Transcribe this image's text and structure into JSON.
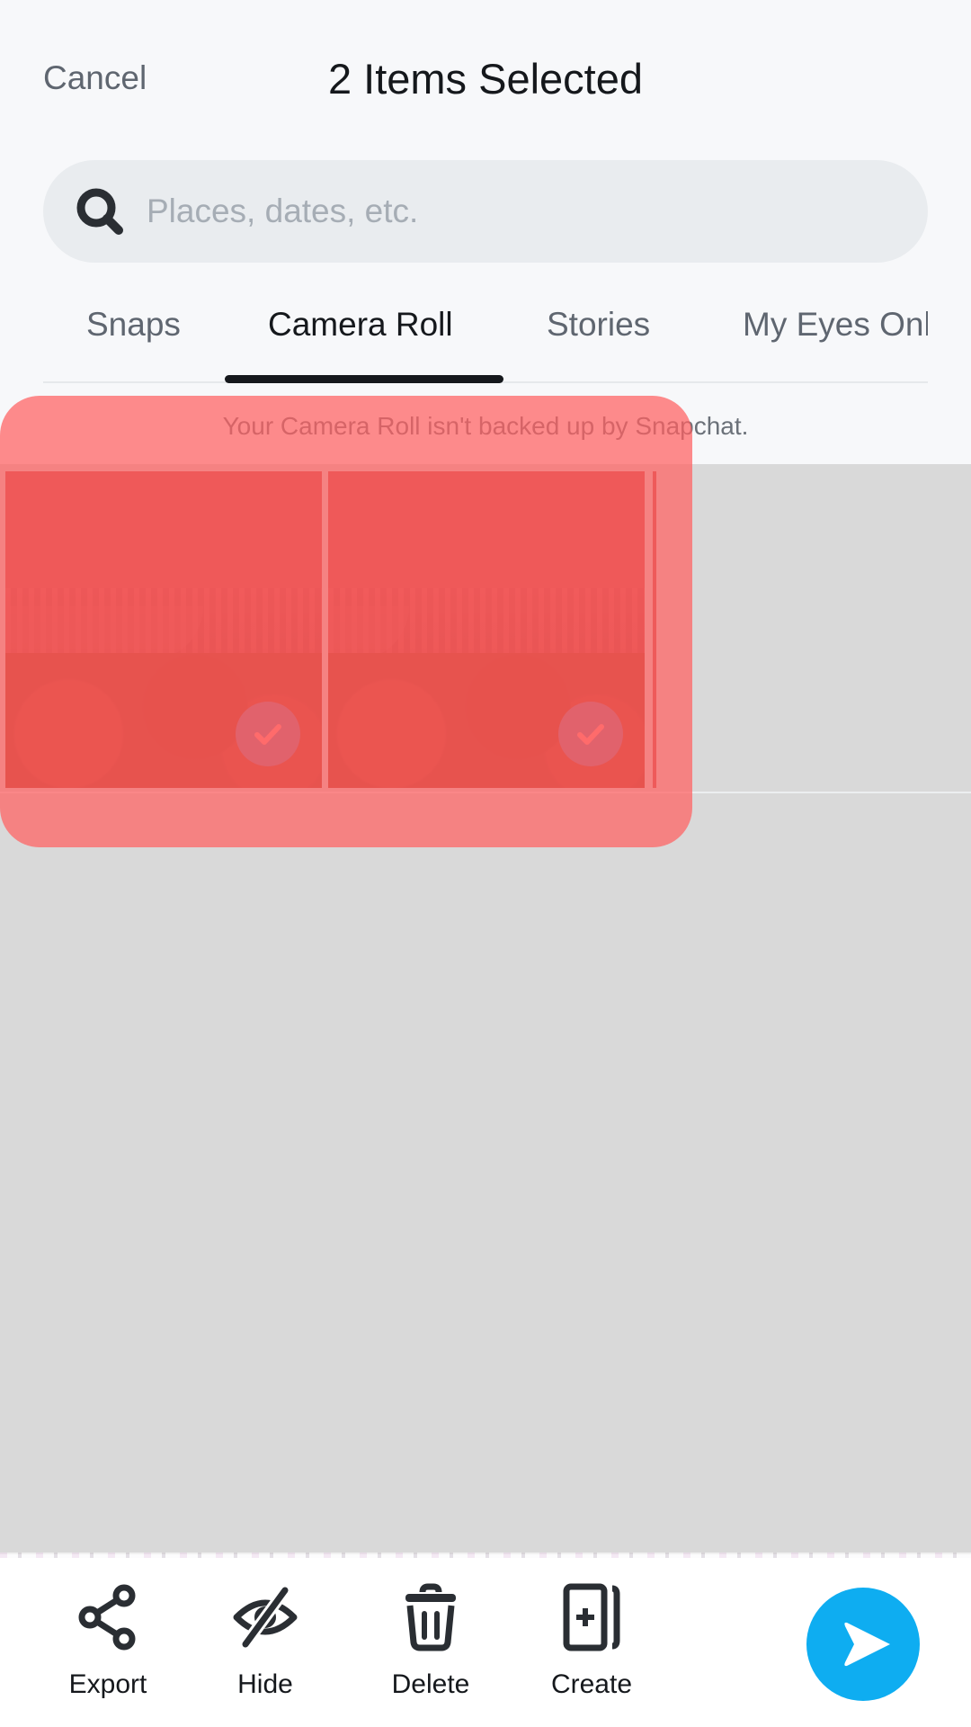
{
  "header": {
    "cancel_label": "Cancel",
    "title": "2 Items Selected"
  },
  "search": {
    "placeholder": "Places, dates, etc.",
    "value": "",
    "icon": "search-icon"
  },
  "tabs": [
    {
      "label": "Snaps",
      "active": false
    },
    {
      "label": "Camera Roll",
      "active": true
    },
    {
      "label": "Stories",
      "active": false
    },
    {
      "label": "My Eyes Only",
      "active": false
    }
  ],
  "notice": "Your Camera Roll isn't backed up by Snapchat.",
  "grid": {
    "items": [
      {
        "description": "Coastal city bay with foliage in foreground",
        "selected": true
      },
      {
        "description": "City skyline with trees in foreground",
        "selected": true
      }
    ]
  },
  "actions": [
    {
      "label": "Export",
      "icon": "share-icon"
    },
    {
      "label": "Hide",
      "icon": "eye-off-icon"
    },
    {
      "label": "Delete",
      "icon": "trash-icon"
    },
    {
      "label": "Create",
      "icon": "add-page-icon"
    }
  ],
  "send": {
    "icon": "send-arrow-icon"
  },
  "colors": {
    "accent_send": "#0eadf1",
    "text_primary": "#15181c",
    "text_secondary": "#5f6670",
    "selection_check": "#936a8d",
    "highlight_overlay": "#ff6060"
  }
}
